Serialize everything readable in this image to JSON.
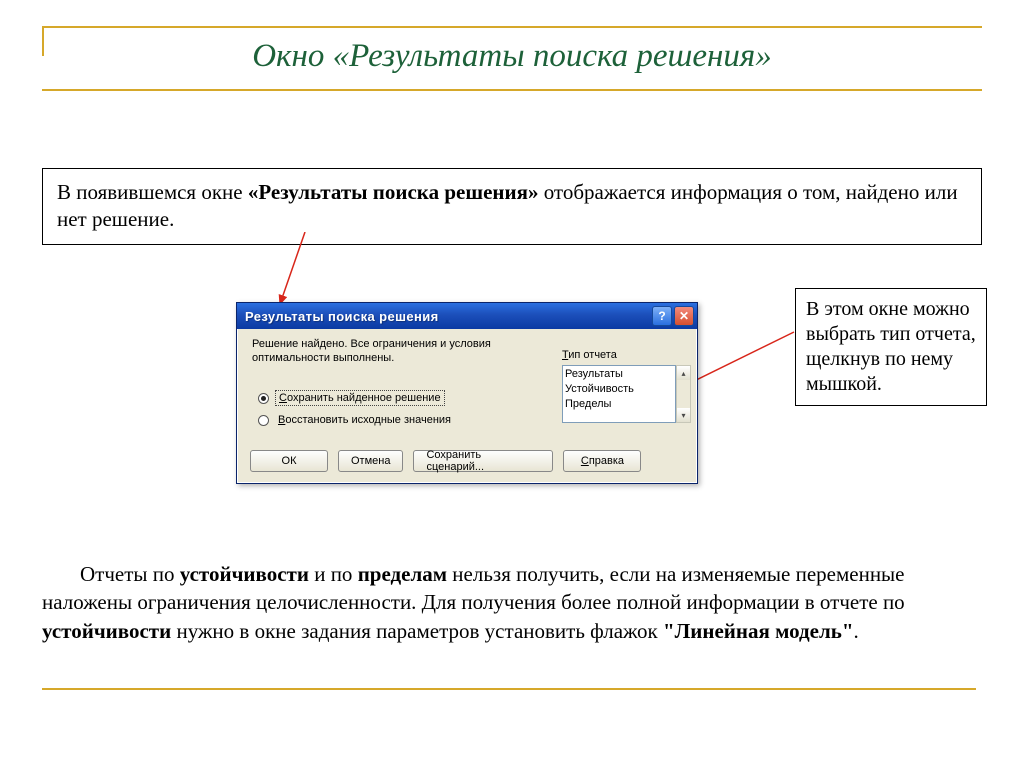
{
  "title": "Окно «Результаты  поиска решения»",
  "intro": {
    "pre": "В появившемся окне ",
    "bold": "«Результаты поиска решения»",
    "post": " отображается информация о том, найдено или нет решение."
  },
  "side_note": "В этом окне можно выбрать тип отчета, щелкнув по нему мышкой.",
  "dialog": {
    "title": "Результаты поиска решения",
    "help_glyph": "?",
    "close_glyph": "✕",
    "status": "Решение найдено. Все ограничения и условия оптимальности выполнены.",
    "report_label_u": "Т",
    "report_label_rest": "ип отчета",
    "options": [
      "Результаты",
      "Устойчивость",
      "Пределы"
    ],
    "radio1_u": "С",
    "radio1_rest": "охранить найденное решение",
    "radio2_u": "В",
    "radio2_rest": "осстановить исходные значения",
    "btn_ok": "ОК",
    "btn_cancel": "Отмена",
    "btn_save": "Сохранить сценарий...",
    "btn_help_u": "С",
    "btn_help_rest": "правка",
    "scroll_up": "▴",
    "scroll_down": "▾"
  },
  "bottom": {
    "t1": "Отчеты по ",
    "b1": "устойчивости",
    "t2": " и по ",
    "b2": "пределам",
    "t3": " нельзя получить, если на изменяемые переменные наложены ограничения целочисленности. Для получения более полной информации в отчете по ",
    "b3": "устойчивости",
    "t4": " нужно в окне задания параметров установить флажок ",
    "b4": "\"Линейная модель\"",
    "t5": "."
  }
}
